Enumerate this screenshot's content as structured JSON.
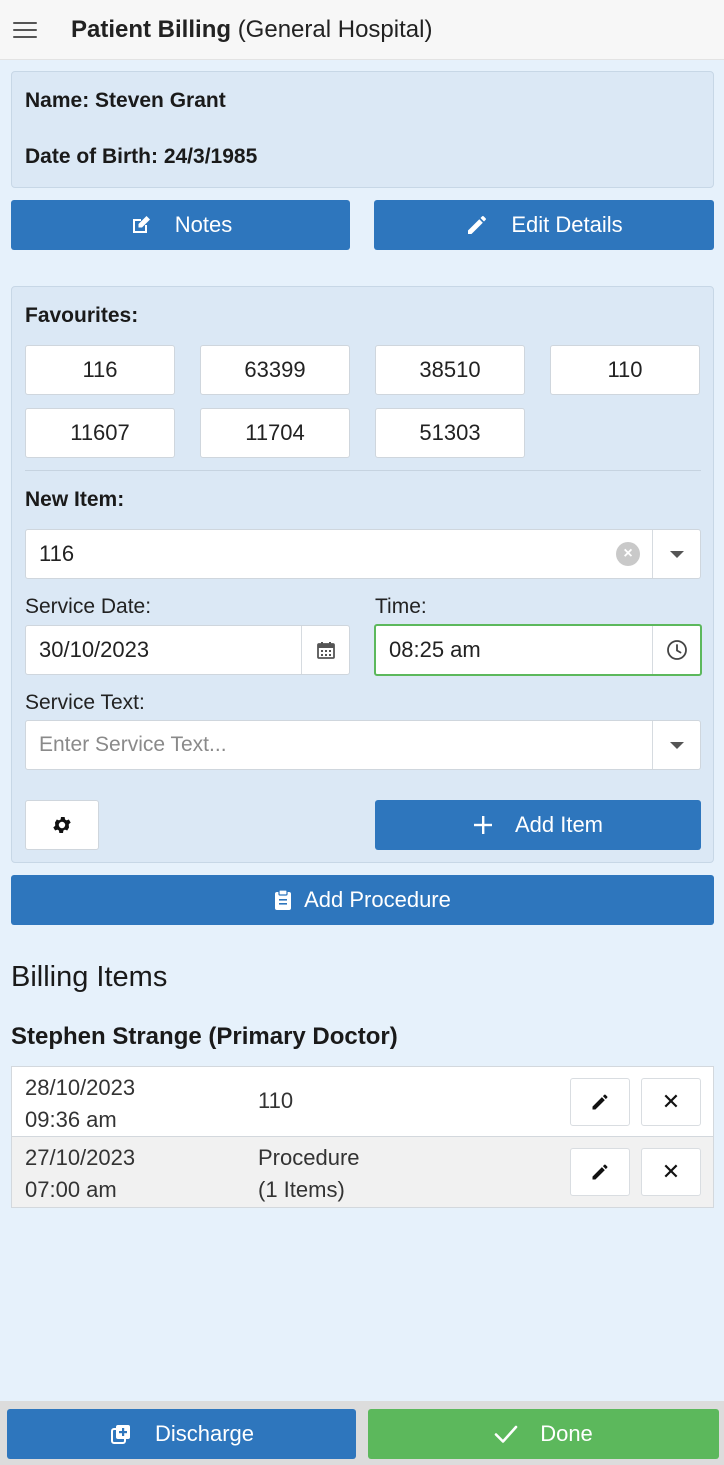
{
  "header": {
    "title": "Patient Billing",
    "subtitle": "(General Hospital)",
    "menu_icon": "menu-icon"
  },
  "patient": {
    "name_line": "Name: Steven Grant",
    "dob_line": "Date of Birth: 24/3/1985"
  },
  "actions": {
    "notes_label": "Notes",
    "notes_icon": "edit-square-icon",
    "edit_details_label": "Edit Details",
    "edit_details_icon": "pencil-icon"
  },
  "favourites": {
    "label": "Favourites:",
    "items": [
      "116",
      "63399",
      "38510",
      "110",
      "11607",
      "11704",
      "51303"
    ]
  },
  "new_item": {
    "label": "New Item:",
    "value": "116",
    "service_date_label": "Service Date:",
    "service_date_value": "30/10/2023",
    "time_label": "Time:",
    "time_value": "08:25 am",
    "service_text_label": "Service Text:",
    "service_text_placeholder": "Enter Service Text...",
    "add_item_label": "Add Item"
  },
  "add_procedure_label": "Add Procedure",
  "billing": {
    "title": "Billing Items",
    "doctor": "Stephen Strange (Primary Doctor)",
    "rows": [
      {
        "date": "28/10/2023",
        "time": "09:36 am",
        "desc1": "110",
        "desc2": ""
      },
      {
        "date": "27/10/2023",
        "time": "07:00 am",
        "desc1": "Procedure",
        "desc2": "(1 Items)"
      }
    ]
  },
  "footer": {
    "discharge_label": "Discharge",
    "done_label": "Done"
  },
  "colors": {
    "primary": "#2e76bd",
    "success": "#5cb85c",
    "background": "#e6f1fb"
  }
}
